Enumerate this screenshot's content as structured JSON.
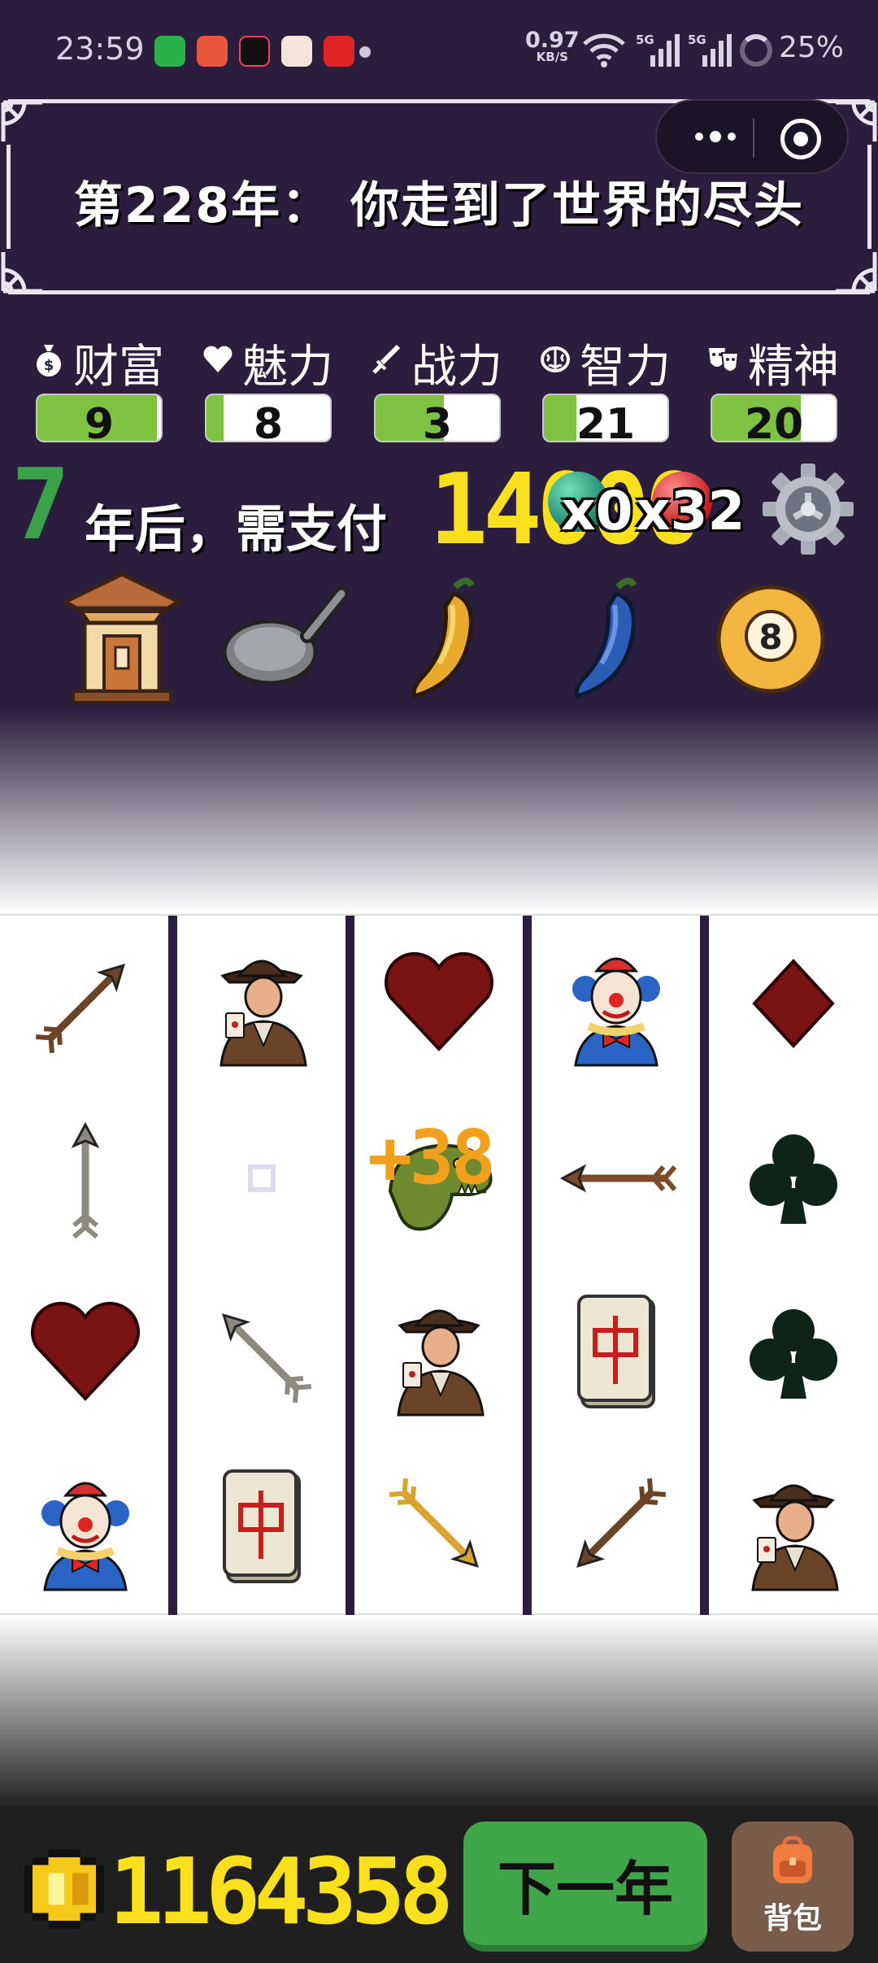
{
  "status_bar": {
    "time": "23:59",
    "net_speed": "0.97",
    "net_unit": "KB/S",
    "signal1": "5G",
    "signal2": "5G",
    "battery": "25%"
  },
  "header": {
    "title": "第228年： 你走到了世界的尽头"
  },
  "stats": [
    {
      "label": "财富",
      "icon": "money-bag-icon",
      "value": "9",
      "fill": 0.97
    },
    {
      "label": "魅力",
      "icon": "heart-icon",
      "value": "8",
      "fill": 0.14
    },
    {
      "label": "战力",
      "icon": "sword-icon",
      "value": "3",
      "fill": 0.55
    },
    {
      "label": "智力",
      "icon": "brain-icon",
      "value": "21",
      "fill": 0.26
    },
    {
      "label": "精神",
      "icon": "mask-icon",
      "value": "20",
      "fill": 0.72
    }
  ],
  "payment": {
    "years": "7",
    "text": "年后，需支付",
    "amount": "14000",
    "green_multiplier": "x0",
    "red_multiplier": "x32"
  },
  "items": [
    "shrine-icon",
    "frying-pan-icon",
    "yellow-pepper-icon",
    "blue-pepper-icon",
    "billiard-8-ball-icon"
  ],
  "grid": [
    [
      "arrow",
      "gambler",
      "heart",
      "clown",
      "diamond"
    ],
    [
      "arrow",
      "empty",
      "dinosaur",
      "arrow",
      "club"
    ],
    [
      "heart",
      "arrow",
      "gambler",
      "mahjong",
      "club"
    ],
    [
      "clown",
      "mahjong",
      "arrow",
      "arrow",
      "gambler"
    ]
  ],
  "bonus": "+38",
  "footer": {
    "coins": "1164358",
    "next_year_label": "下一年",
    "bag_label": "背包"
  }
}
